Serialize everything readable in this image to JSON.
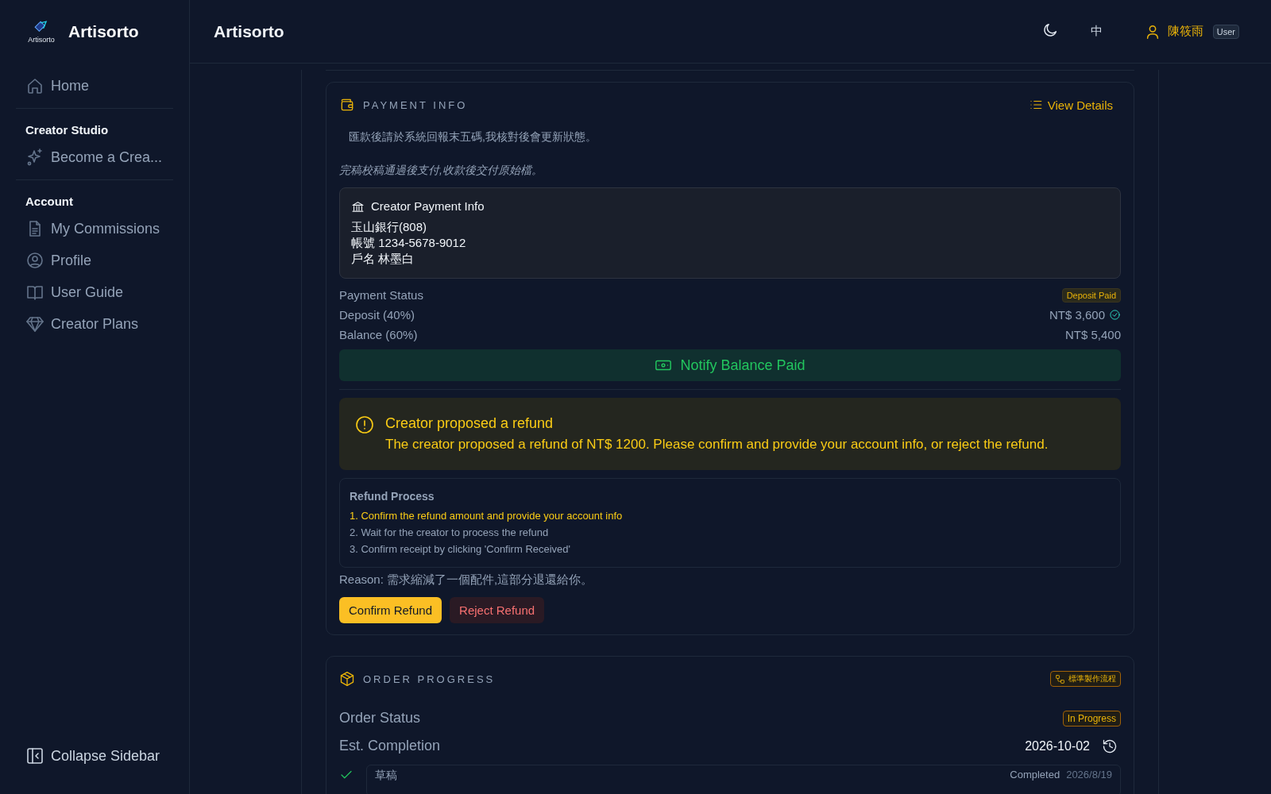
{
  "sidebar": {
    "brand": {
      "logo_caption": "Artisorto",
      "name": "Artisorto"
    },
    "sections": [
      {
        "items": [
          {
            "kind": "home",
            "label": "Home"
          }
        ]
      },
      {
        "heading": "Creator Studio",
        "items": [
          {
            "kind": "sparkle",
            "label": "Become a Crea..."
          }
        ]
      },
      {
        "heading": "Account",
        "items": [
          {
            "kind": "file",
            "label": "My Commissions"
          },
          {
            "kind": "user",
            "label": "Profile"
          },
          {
            "kind": "book",
            "label": "User Guide"
          },
          {
            "kind": "gem",
            "label": "Creator Plans"
          }
        ]
      }
    ],
    "collapse": "Collapse Sidebar"
  },
  "header": {
    "title": "Artisorto",
    "language": "中",
    "user": {
      "name": "陳筱雨",
      "role": "User"
    }
  },
  "payment": {
    "title": "PAYMENT INFO",
    "details_link": "View Details",
    "note": "匯款後請於系統回報末五碼,我核對後會更新狀態。",
    "terms": "完稿校稿通過後支付,收款後交付原始檔。",
    "bank": {
      "title": "Creator Payment Info",
      "lines": [
        "玉山銀行(808)",
        "帳號 1234-5678-9012",
        "戶名 林墨白"
      ]
    },
    "rows": [
      {
        "label": "Payment Status",
        "kind": "badge",
        "value": "Deposit Paid"
      },
      {
        "label": "Deposit (40%)",
        "kind": "amount",
        "value": "NT$ 3,600",
        "paid": true
      },
      {
        "label": "Balance (60%)",
        "kind": "amount",
        "value": "NT$ 5,400",
        "paid": false
      }
    ],
    "notify_button": "Notify Balance Paid",
    "alert": {
      "title": "Creator proposed a refund",
      "message": "The creator proposed a refund of NT$ 1200. Please confirm and provide your account info, or reject the refund."
    },
    "process": {
      "title": "Refund Process",
      "steps": [
        {
          "text": "1. Confirm the refund amount and provide your account info",
          "current": true
        },
        {
          "text": "2. Wait for the creator to process the refund",
          "current": false
        },
        {
          "text": "3. Confirm receipt by clicking 'Confirm Received'",
          "current": false
        }
      ]
    },
    "reason": "Reason: 需求縮減了一個配件,這部分退還給你。",
    "buttons": [
      {
        "label": "Confirm Refund",
        "kind": "primary"
      },
      {
        "label": "Reject Refund",
        "kind": "danger"
      }
    ]
  },
  "progress": {
    "title": "ORDER PROGRESS",
    "workflow": "標準製作流程",
    "rows": [
      {
        "label": "Order Status",
        "kind": "badge",
        "value": "In Progress"
      },
      {
        "label": "Est. Completion",
        "kind": "date",
        "value": "2026-10-02"
      }
    ],
    "steps": [
      {
        "name": "草稿",
        "done": true,
        "status": "Completed",
        "date": "2026/8/19"
      }
    ]
  }
}
